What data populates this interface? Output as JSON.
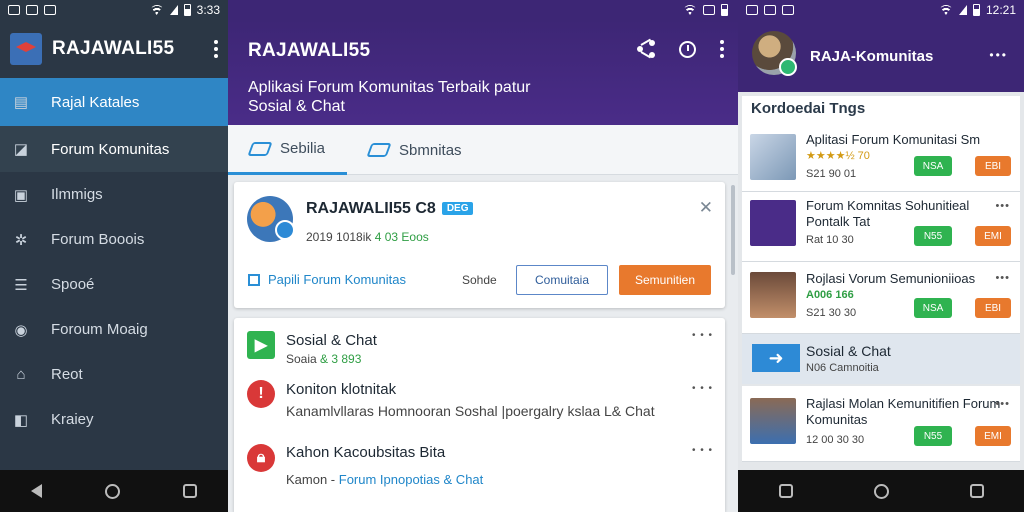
{
  "status": {
    "left_time": "3:33",
    "right_time": "12:21"
  },
  "drawer": {
    "title": "RAJAWALI55",
    "items": [
      {
        "label": "Rajal Katales",
        "icon": "book-icon"
      },
      {
        "label": "Forum Komunitas",
        "icon": "chat-icon"
      },
      {
        "label": "Ilmmigs",
        "icon": "image-icon"
      },
      {
        "label": "Forum Booois",
        "icon": "gear-icon"
      },
      {
        "label": "Spooé",
        "icon": "list-icon"
      },
      {
        "label": "Foroum  Moaig",
        "icon": "help-icon"
      },
      {
        "label": "Reot",
        "icon": "home-icon"
      },
      {
        "label": "Kraiey",
        "icon": "bag-icon"
      }
    ]
  },
  "center": {
    "appbar_title": "RAJAWALI55",
    "subtitle": "Aplikasi Forum Komunitas Terbaik patur Sosial & Chat",
    "tabs": [
      {
        "label": "Sebilia"
      },
      {
        "label": "Sbmnitas"
      }
    ],
    "card": {
      "title": "RAJAWALII55 C8",
      "badge": "DEG",
      "meta_prefix": "2019 1018ik",
      "meta_green": "4 03 Eoos",
      "link": "Papili Forum Komunitas",
      "secondary": "Sohde",
      "btn_outline": "Comuitaia",
      "btn_primary": "Semunitien"
    },
    "feed": [
      {
        "title": "Sosial & Chat",
        "sub_plain": "Soaia ",
        "sub_green": "& 3 893",
        "more": "• • •"
      },
      {
        "title": "Koniton klotnitak",
        "sub_plain": "Kanamlvllaras Homnooran Soshal |poergalry kslaa L& Chat",
        "sub_green": "",
        "more": "• • •"
      },
      {
        "title": "Kahon Kacoubsitas Bita",
        "sub_plain": "Kamon - ",
        "sub_blue": "Forum Ipnopotias & Chat",
        "more": "• • •"
      }
    ]
  },
  "right": {
    "title": "RAJA-Komunitas",
    "section": "Kordoedai Tngs",
    "items": [
      {
        "name": "Aplitasi Forum Komunitasi Sm",
        "meta": "★★★★½ 70",
        "meta2": "S21 90 01",
        "green": "NSA",
        "orange": "EBI"
      },
      {
        "name": "Forum Komnitas Sohunitieal Pontalk Tat",
        "meta": "Rat 10 30",
        "meta2": "",
        "green": "N55",
        "orange": "EMI"
      },
      {
        "name": "Rojlasi Vorum Semunioniioas",
        "meta": "A006 166",
        "meta2": "S21 30 30",
        "green": "NSA",
        "orange": "EBI"
      },
      {
        "name": "Rajlasi Molan Kemunitifien Forum Komunitas",
        "meta": "12 00 30 30",
        "meta2": "",
        "green": "N55",
        "orange": "EMI"
      }
    ],
    "social": {
      "title": "Sosial & Chat",
      "sub": "N06 Camnoitia"
    }
  }
}
